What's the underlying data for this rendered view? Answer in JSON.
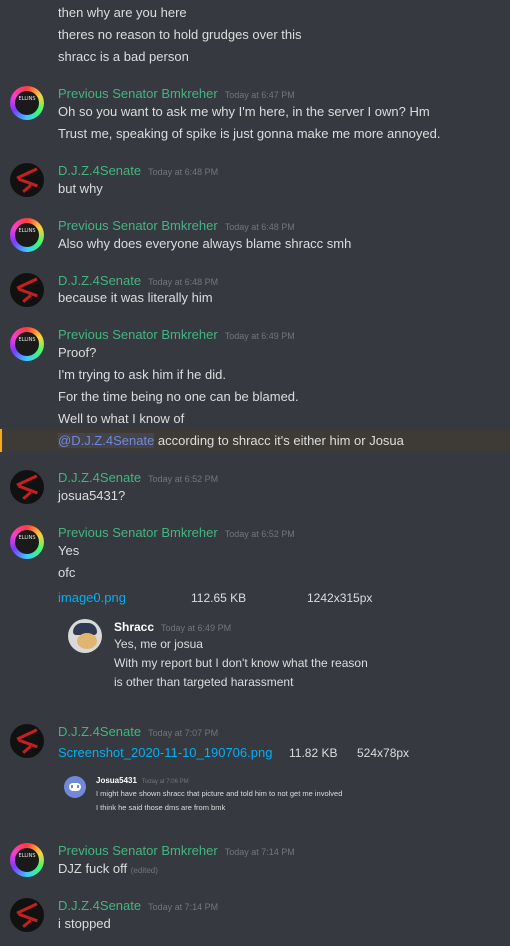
{
  "messages": {
    "cont_lines": [
      "then why are you here",
      "theres no reason to hold grudges over this",
      "shracc is a bad person"
    ],
    "m1": {
      "author": "Previous Senator Bmkreher",
      "time": "Today at 6:47 PM",
      "lines": [
        "Oh so you want to ask me why I'm here, in the server I own? Hm",
        "Trust me, speaking of spike is just gonna make me more annoyed."
      ]
    },
    "m2": {
      "author": "D.J.Z.4Senate",
      "time": "Today at 6:48 PM",
      "lines": [
        "but why"
      ]
    },
    "m3": {
      "author": "Previous Senator Bmkreher",
      "time": "Today at 6:48 PM",
      "lines": [
        "Also why does everyone always blame shracc smh"
      ]
    },
    "m4": {
      "author": "D.J.Z.4Senate",
      "time": "Today at 6:48 PM",
      "lines": [
        "because it was literally him"
      ]
    },
    "m5": {
      "author": "Previous Senator Bmkreher",
      "time": "Today at 6:49 PM",
      "lines": [
        "Proof?",
        "I'm trying to ask him if he did.",
        "For the time being no one can be blamed.",
        "Well to what I know of"
      ],
      "mention": "@D.J.Z.4Senate",
      "mention_rest": " according to shracc it's either him or Josua"
    },
    "m6": {
      "author": "D.J.Z.4Senate",
      "time": "Today at 6:52 PM",
      "lines": [
        "josua5431?"
      ]
    },
    "m7": {
      "author": "Previous Senator Bmkreher",
      "time": "Today at 6:52 PM",
      "lines": [
        "Yes",
        "ofc"
      ],
      "attachment": {
        "name": "image0.png",
        "size": "112.65 KB",
        "dims": "1242x315px"
      },
      "embed": {
        "author": "Shracc",
        "time": "Today at 6:49 PM",
        "lines": [
          "Yes, me or josua",
          "With my report but I don't know what the reason",
          "is other than targeted harassment"
        ]
      }
    },
    "m8": {
      "author": "D.J.Z.4Senate",
      "time": "Today at 7:07 PM",
      "attachment": {
        "name": "Screenshot_2020-11-10_190706.png",
        "size": "11.82 KB",
        "dims": "524x78px"
      },
      "embed": {
        "author": "Josua5431",
        "time": "Today at 7:06 PM",
        "lines": [
          "I might have shown shracc that picture and told him to not get me involved",
          "I think he said those dms are from bmk"
        ]
      }
    },
    "m9": {
      "author": "Previous Senator Bmkreher",
      "time": "Today at 7:14 PM",
      "lines": [
        "DJZ fuck off"
      ],
      "edited": "(edited)"
    },
    "m10": {
      "author": "D.J.Z.4Senate",
      "time": "Today at 7:14 PM",
      "lines": [
        "i stopped"
      ]
    }
  },
  "avatars": {
    "bmk_text": "ELLINS",
    "bmk_colors": [
      "#ff3b3b",
      "#ffd23b",
      "#3bff6a",
      "#3bc9ff",
      "#7a3bff"
    ],
    "djz_colors": [
      "#111111",
      "#c42020"
    ]
  },
  "colors": {
    "background": "#36393f",
    "text": "#dcddde",
    "bmk_name": "#43b581",
    "djz_name": "#43b581",
    "timestamp": "#72767d",
    "mention": "#7289da",
    "link": "#00b0f4",
    "highlight_border": "#faa61a"
  }
}
